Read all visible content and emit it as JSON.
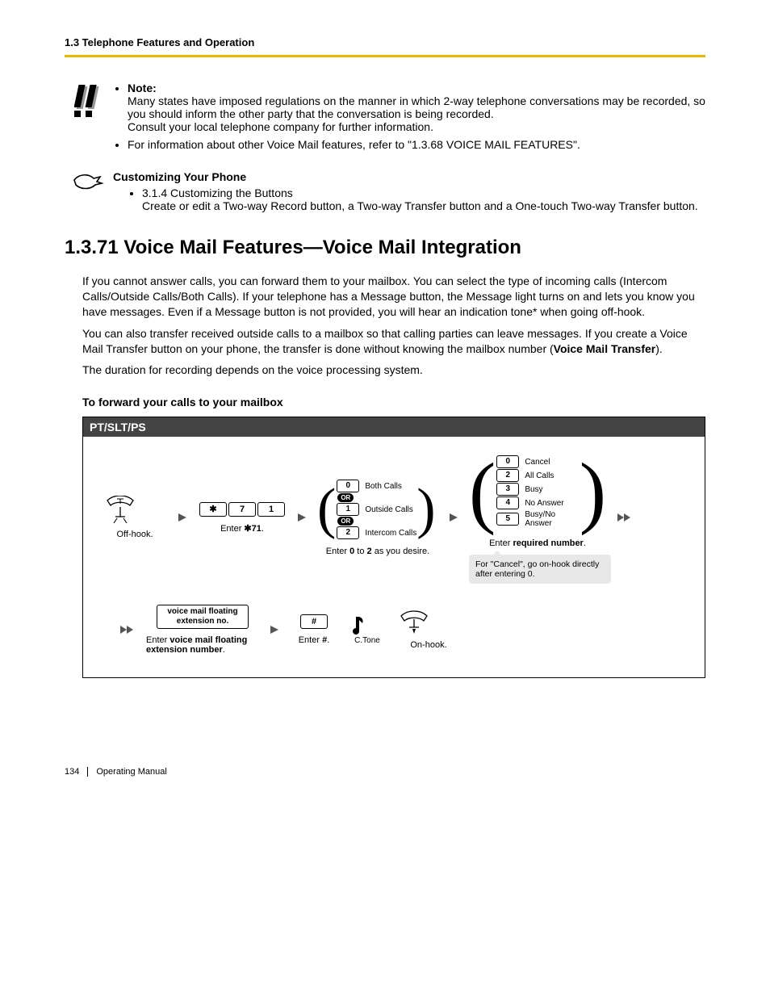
{
  "header": {
    "running": "1.3 Telephone Features and Operation"
  },
  "note": {
    "label": "Note:",
    "text1": "Many states have imposed regulations on the manner in which 2-way telephone conversations may be recorded, so you should inform the other party that the conversation is being recorded.",
    "text2": "Consult your local telephone company for further information.",
    "bullet2": "For information about other Voice Mail features, refer to \"1.3.68 VOICE MAIL FEATURES\"."
  },
  "customizing": {
    "title": "Customizing Your Phone",
    "li1": "3.1.4 Customizing the Buttons",
    "li2": "Create or edit a Two-way Record button, a Two-way Transfer button and a One-touch Two-way Transfer button."
  },
  "section": {
    "heading": "1.3.71  Voice Mail Features—Voice Mail Integration",
    "para1": "If you cannot answer calls, you can forward them to your mailbox. You can select the type of incoming calls (Intercom Calls/Outside Calls/Both Calls). If your telephone has a Message button, the Message light turns on and lets you know you have messages. Even if a Message button is not provided, you will hear an indication tone* when going off-hook.",
    "para2a": "You can also transfer received outside calls to a mailbox so that calling parties can leave messages. If you create a Voice Mail Transfer button on your phone, the transfer is done without knowing the mailbox number (",
    "para2b": "Voice Mail Transfer",
    "para2c": ").",
    "para3": "The duration for recording depends on the voice processing system.",
    "subhead": "To forward your calls to your mailbox"
  },
  "procedure": {
    "title": "PT/SLT/PS",
    "row1": {
      "offhook_caption": "Off-hook.",
      "keys": {
        "k1": "✱",
        "k2": "7",
        "k3": "1"
      },
      "enter71_pre": "Enter ",
      "enter71_mid": "✱71",
      "enter71_suf": ".",
      "callType": {
        "k0": "0",
        "l0": "Both Calls",
        "or": "OR",
        "k1": "1",
        "l1": "Outside Calls",
        "k2": "2",
        "l2": "Intercom Calls"
      },
      "enter02_pre": "Enter ",
      "enter02_b1": "0",
      "enter02_mid": " to ",
      "enter02_b2": "2",
      "enter02_suf": " as you desire.",
      "required": {
        "k0": "0",
        "l0": "Cancel",
        "k2": "2",
        "l2": "All Calls",
        "k3": "3",
        "l3": "Busy",
        "k4": "4",
        "l4": "No Answer",
        "k5": "5",
        "l5": "Busy/No Answer"
      },
      "enterreq_pre": "Enter ",
      "enterreq_b": "required number",
      "enterreq_suf": ".",
      "tooltip": "For \"Cancel\", go on-hook directly after entering 0."
    },
    "row2": {
      "input_label": "voice mail floating extension no.",
      "input_cap_pre": "Enter ",
      "input_cap_b": "voice mail floating extension number",
      "input_cap_suf": ".",
      "hash": "#",
      "hash_cap_pre": "Enter ",
      "hash_cap_b": "#",
      "hash_cap_suf": ".",
      "ctone": "C.Tone",
      "onhook_caption": "On-hook."
    }
  },
  "footer": {
    "page": "134",
    "title": "Operating Manual"
  }
}
